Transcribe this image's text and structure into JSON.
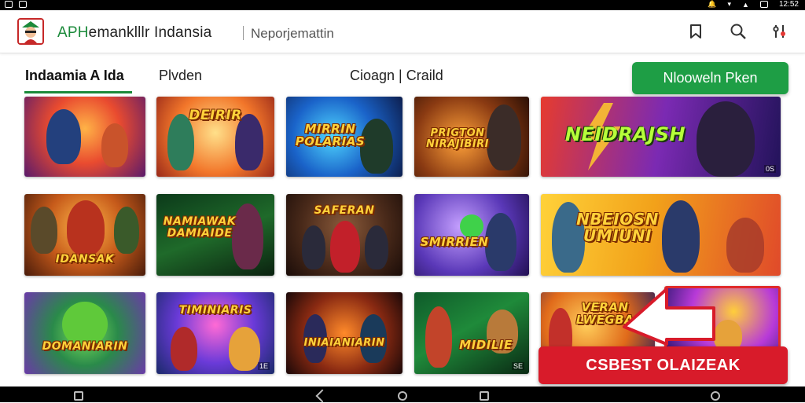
{
  "status_bar": {
    "time": "12:52",
    "icons": [
      "notification-icon",
      "notification-icon",
      "mute-icon",
      "wifi-icon",
      "signal-icon",
      "battery-icon"
    ]
  },
  "app_bar": {
    "title_accent": "APH",
    "title_rest": "emanklllr Indansia",
    "subtitle": "Neporjemattin",
    "icons": [
      "bookmark-icon",
      "search-icon",
      "settings-icon"
    ]
  },
  "tabs": [
    {
      "label": "Indaamia A Ida",
      "active": true
    },
    {
      "label": "Plvden",
      "active": false
    },
    {
      "label": "Cioagn | Craild",
      "active": false
    }
  ],
  "cta_label": "Nlooweln Pken",
  "games": [
    {
      "title": "",
      "tag": ""
    },
    {
      "title": "DEIRIR",
      "tag": ""
    },
    {
      "title": "MIRRIN POLARIAS",
      "tag": ""
    },
    {
      "title": "PRIGTON NIRAJIBIRI",
      "tag": ""
    },
    {
      "title": "NEIDRAJSH",
      "tag": "0S"
    },
    {
      "title": "IDANSAK",
      "tag": ""
    },
    {
      "title": "NAMIAWAK DAMIAIDE",
      "tag": ""
    },
    {
      "title": "SAFERAN",
      "tag": ""
    },
    {
      "title": "SMIRRIEN",
      "tag": ""
    },
    {
      "title": "NBEIOSN UMIUNI",
      "tag": ""
    },
    {
      "title": "DOMANIARIN",
      "tag": ""
    },
    {
      "title": "TIMINIARIS",
      "tag": "1E"
    },
    {
      "title": "INIAIANIARIN",
      "tag": ""
    },
    {
      "title": "MIDILIE",
      "tag": "SE"
    },
    {
      "title": "VERAN LWEGBA",
      "tag": ""
    }
  ],
  "promo_button": "CSBEST OLAIZEAK",
  "colors": {
    "accent_green": "#1e9e45",
    "promo_red": "#d81b2a"
  }
}
